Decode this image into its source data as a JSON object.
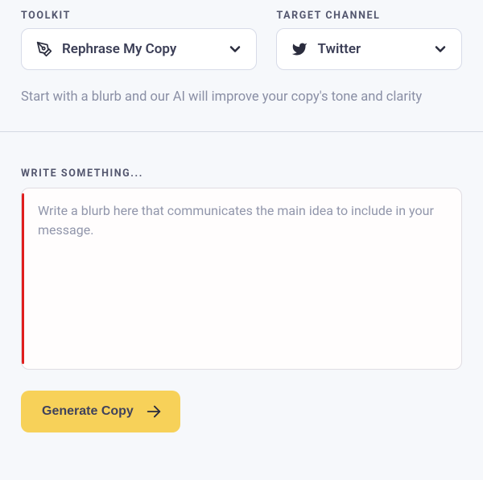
{
  "toolkit": {
    "label": "TOOLKIT",
    "selected": "Rephrase My Copy"
  },
  "target_channel": {
    "label": "TARGET CHANNEL",
    "selected": "Twitter"
  },
  "description": "Start with a blurb and our AI will improve your copy's tone and clarity",
  "write": {
    "label": "WRITE SOMETHING...",
    "placeholder": "Write a blurb here that communicates the main idea to include in your message.",
    "value": ""
  },
  "generate": {
    "label": "Generate Copy"
  }
}
